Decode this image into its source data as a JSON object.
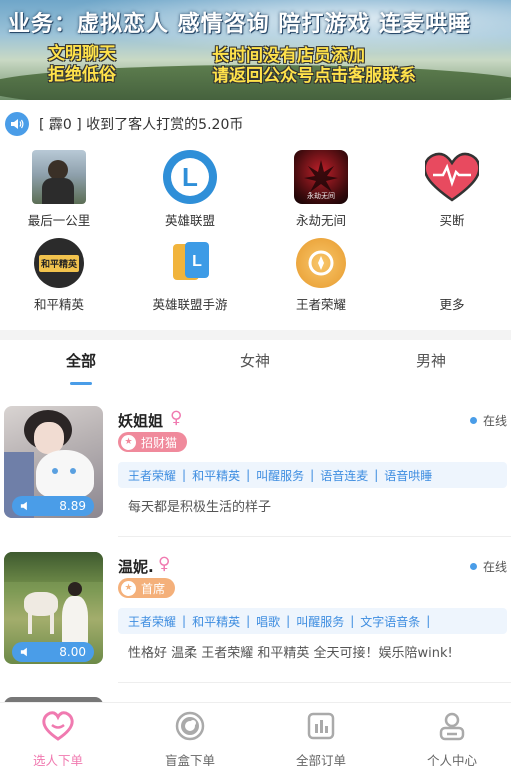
{
  "banner": {
    "line1": "业务：虚拟恋人 感情咨询 陪打游戏 连麦哄睡",
    "left_l1": "文明聊天",
    "left_l2": "拒绝低俗",
    "right_l1": "长时间没有店员添加",
    "right_l2": "请返回公众号点击客服联系"
  },
  "notice": {
    "text": "[ 霹0 ] 收到了客人打赏的5.20币"
  },
  "categories": [
    {
      "label": "最后一公里",
      "icon": "avatar-photo-icon"
    },
    {
      "label": "英雄联盟",
      "icon": "league-of-legends-icon"
    },
    {
      "label": "永劫无间",
      "icon": "naraka-icon"
    },
    {
      "label": "买断",
      "icon": "heart-pulse-icon"
    },
    {
      "label": "和平精英",
      "icon": "peace-elite-icon"
    },
    {
      "label": "英雄联盟手游",
      "icon": "lol-mobile-icon"
    },
    {
      "label": "王者荣耀",
      "icon": "honor-of-kings-icon"
    },
    {
      "label": "更多",
      "icon": "more-icon"
    }
  ],
  "tabs": [
    {
      "label": "全部",
      "active": true
    },
    {
      "label": "女神",
      "active": false
    },
    {
      "label": "男神",
      "active": false
    }
  ],
  "cards": [
    {
      "name": "妖姐姐",
      "sex": "♀",
      "status": "在线",
      "badge": "招财猫",
      "badge_color": "#f08a9c",
      "score": "8.89",
      "tags": [
        "王者荣耀",
        "和平精英",
        "叫醒服务",
        "语音连麦",
        "语音哄睡"
      ],
      "desc": "每天都是积极生活的样子"
    },
    {
      "name": "温妮.",
      "sex": "♀",
      "status": "在线",
      "badge": "首席",
      "badge_color": "#f4b07a",
      "score": "8.00",
      "tags": [
        "王者荣耀",
        "和平精英",
        "唱歌",
        "叫醒服务",
        "文字语音条"
      ],
      "desc": "性格好 温柔 王者荣耀 和平精英 全天可接！娱乐陪wink!"
    }
  ],
  "bottom_nav": [
    {
      "label": "选人下单",
      "active": true
    },
    {
      "label": "盲盒下单",
      "active": false
    },
    {
      "label": "全部订单",
      "active": false
    },
    {
      "label": "个人中心",
      "active": false
    }
  ],
  "colors": {
    "accent": "#4a9de8",
    "pink": "#f07ab0"
  }
}
